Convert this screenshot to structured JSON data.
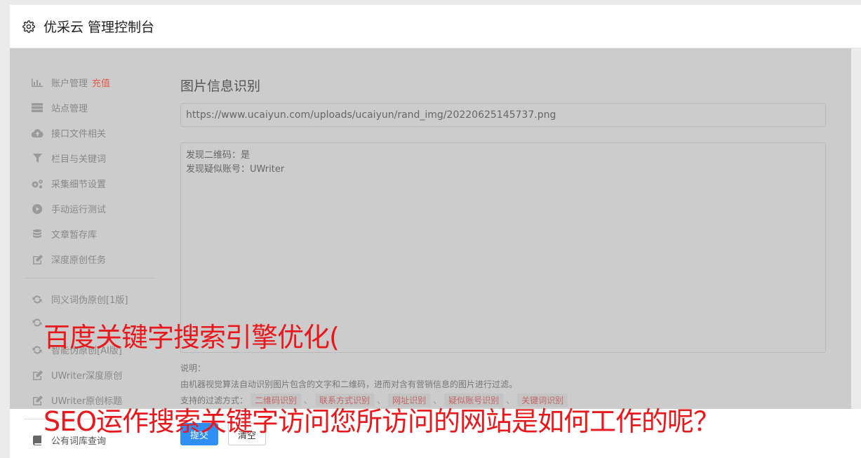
{
  "header": {
    "title": "优采云 管理控制台"
  },
  "sidebar": {
    "items": [
      {
        "label": "账户管理",
        "extra": "充值",
        "icon": "bar-chart-icon"
      },
      {
        "label": "站点管理",
        "icon": "server-icon"
      },
      {
        "label": "接口文件相关",
        "icon": "cloud-upload-icon"
      },
      {
        "label": "栏目与关键词",
        "icon": "filter-icon"
      },
      {
        "label": "采集细节设置",
        "icon": "cogs-icon"
      },
      {
        "label": "手动运行测试",
        "icon": "play-circle-icon"
      },
      {
        "label": "文章暂存库",
        "icon": "database-icon"
      },
      {
        "label": "深度原创任务",
        "icon": "edit-icon"
      },
      {
        "label": "同义词伪原创[1版]",
        "icon": "refresh-icon"
      },
      {
        "label": "",
        "icon": "refresh-icon"
      },
      {
        "label": "智能伪原创[AI版]",
        "icon": "refresh-icon"
      },
      {
        "label": "UWriter深度原创",
        "icon": "edit-icon"
      },
      {
        "label": "UWriter原创标题",
        "icon": "edit-icon"
      },
      {
        "label": "公有词库查询",
        "icon": "book-icon"
      }
    ]
  },
  "main": {
    "title": "图片信息识别",
    "url_value": "https://www.ucaiyun.com/uploads/ucaiyun/rand_img/20220625145737.png",
    "result_lines": [
      "发现二维码：是",
      "发现疑似账号：UWriter"
    ],
    "desc_label": "说明：",
    "desc_text": "由机器视觉算法自动识别图片包含的文字和二维码，进而对含有营销信息的图片进行过滤。",
    "filters_label": "支持的过滤方式：",
    "filters": [
      "二维码识别",
      "联系方式识别",
      "网址识别",
      "疑似账号识别",
      "关键词识别"
    ],
    "separator": "、",
    "submit_label": "提交",
    "clear_label": "清空"
  },
  "caption": {
    "line1": "百度关键字搜索引擎优化(",
    "line2": "SEO运作搜索关键字访问您所访问的网站是如何工作的呢？"
  },
  "colors": {
    "accent": "#2f8ff5",
    "caption": "#e8181c",
    "recharge": "#e05a4a"
  }
}
